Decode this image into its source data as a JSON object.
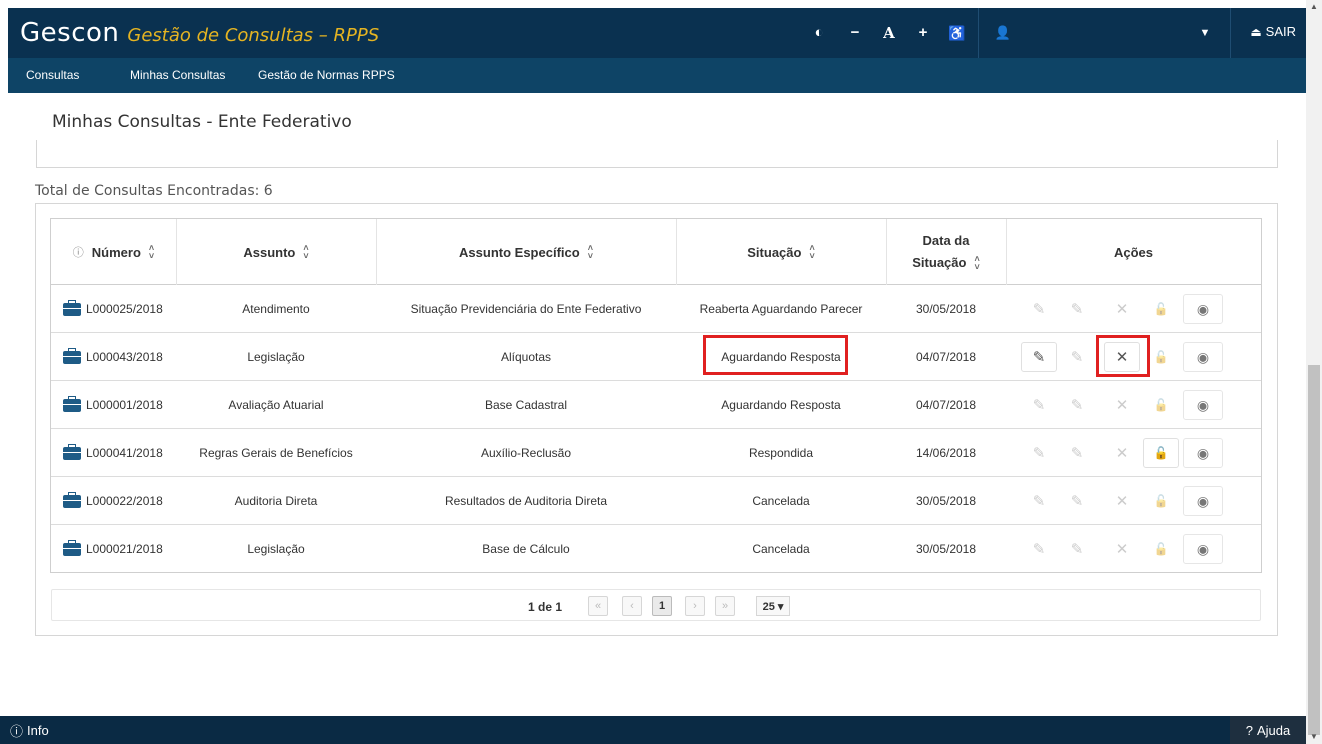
{
  "header": {
    "brand": "Gescon",
    "subtitle": "Gestão de Consultas – RPPS",
    "contrast_icon": "half-circle-icon",
    "font_decrease": "−",
    "font_default": "A",
    "font_increase": "+",
    "accessibility_icon": "wheelchair-icon",
    "logout_label": "SAIR"
  },
  "nav": {
    "items": [
      "Consultas",
      "Minhas Consultas",
      "Gestão de Normas RPPS"
    ]
  },
  "page": {
    "title": "Minhas Consultas - Ente Federativo",
    "total_label": "Total de Consultas Encontradas: 6"
  },
  "table": {
    "columns": {
      "numero": "Número",
      "assunto": "Assunto",
      "especifico": "Assunto Específico",
      "situacao": "Situação",
      "data_l1": "Data da",
      "data_l2": "Situação",
      "acoes": "Ações"
    },
    "rows": [
      {
        "numero": "L000025/2018",
        "assunto": "Atendimento",
        "especifico": "Situação Previdenciária do Ente Federativo",
        "situacao": "Reaberta Aguardando Parecer",
        "data": "30/05/2018"
      },
      {
        "numero": "L000043/2018",
        "assunto": "Legislação",
        "especifico": "Alíquotas",
        "situacao": "Aguardando Resposta",
        "data": "04/07/2018"
      },
      {
        "numero": "L000001/2018",
        "assunto": "Avaliação Atuarial",
        "especifico": "Base Cadastral",
        "situacao": "Aguardando Resposta",
        "data": "04/07/2018"
      },
      {
        "numero": "L000041/2018",
        "assunto": "Regras Gerais de Benefícios",
        "especifico": "Auxílio-Reclusão",
        "situacao": "Respondida",
        "data": "14/06/2018"
      },
      {
        "numero": "L000022/2018",
        "assunto": "Auditoria Direta",
        "especifico": "Resultados de Auditoria Direta",
        "situacao": "Cancelada",
        "data": "30/05/2018"
      },
      {
        "numero": "L000021/2018",
        "assunto": "Legislação",
        "especifico": "Base de Cálculo",
        "situacao": "Cancelada",
        "data": "30/05/2018"
      }
    ]
  },
  "pagination": {
    "label": "1 de 1",
    "current": "1",
    "page_size": "25 ▾"
  },
  "footer": {
    "info_label": "Info",
    "help_label": "Ajuda"
  },
  "colors": {
    "header_bg": "#0a3150",
    "nav_bg": "#0e4466",
    "accent_yellow": "#e5b422",
    "highlight_red": "#e02020"
  }
}
